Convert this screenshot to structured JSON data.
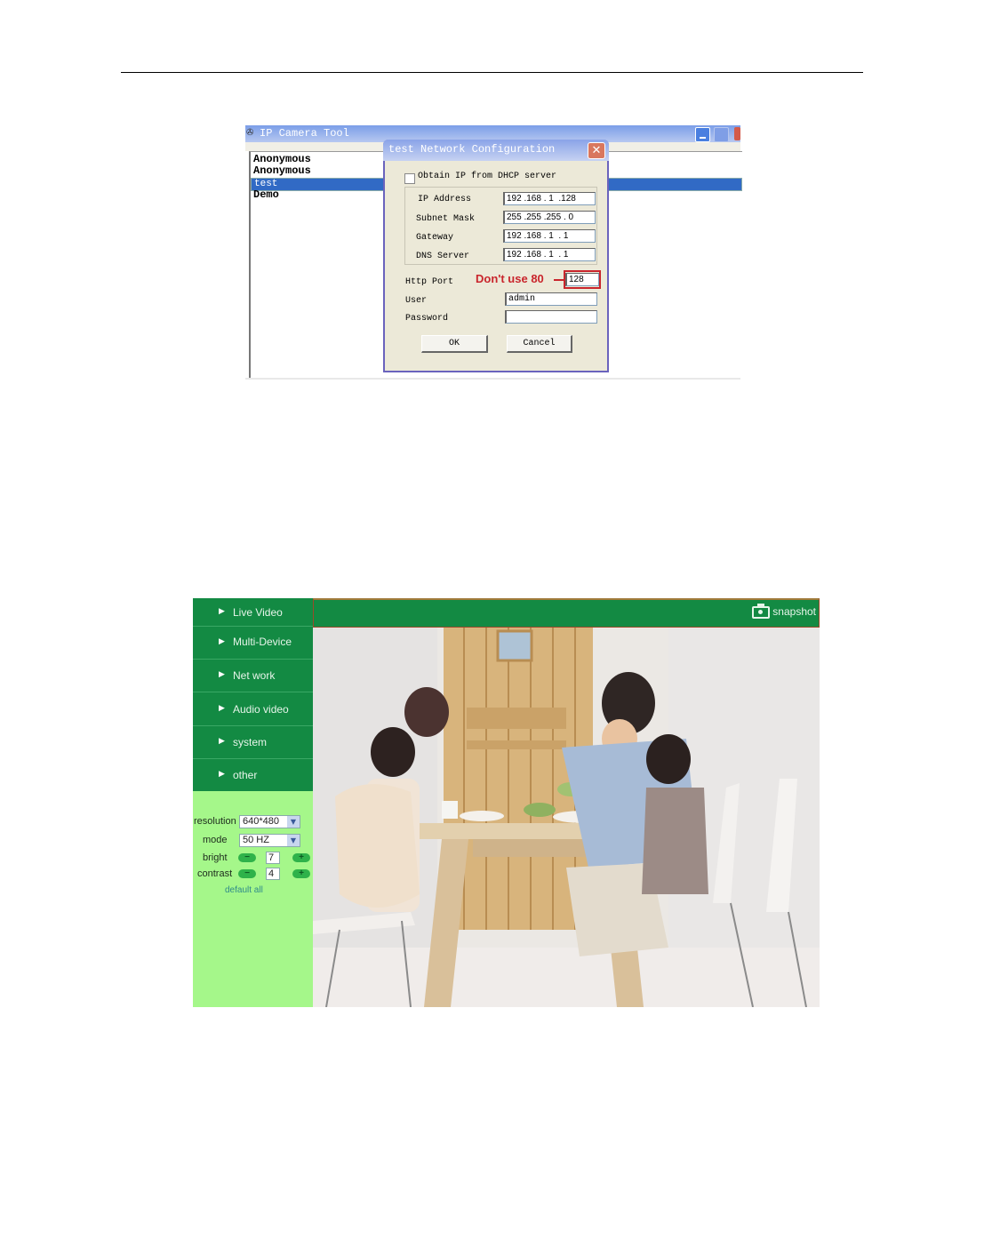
{
  "app_window": {
    "title": "IP Camera Tool",
    "app_icon": "camera-tool-icon",
    "controls": [
      "minimize",
      "maximize",
      "close"
    ],
    "device_list": [
      {
        "name": "Anonymous",
        "selected": false
      },
      {
        "name": "Anonymous",
        "selected": false
      },
      {
        "name": "test",
        "selected": true
      },
      {
        "name": "Demo",
        "selected": false
      }
    ]
  },
  "dialog": {
    "title": "test Network Configuration",
    "close_icon": "close-icon",
    "dhcp_label": "Obtain IP from DHCP server",
    "dhcp_checked": false,
    "fields": [
      {
        "label": "IP Address",
        "value": "192 .168 . 1  .128"
      },
      {
        "label": "Subnet Mask",
        "value": "255 .255 .255 . 0"
      },
      {
        "label": "Gateway",
        "value": "192 .168 . 1  . 1"
      },
      {
        "label": "DNS Server",
        "value": "192 .168 . 1  . 1"
      }
    ],
    "http_port": {
      "label": "Http Port",
      "value": "128"
    },
    "user": {
      "label": "User",
      "value": "admin"
    },
    "password": {
      "label": "Password",
      "value": ""
    },
    "annotation": "Don't use 80",
    "ok_label": "OK",
    "cancel_label": "Cancel"
  },
  "web_ui": {
    "menu": [
      {
        "label": "Live Video"
      },
      {
        "label": "Multi-Device"
      },
      {
        "label": "Net work"
      },
      {
        "label": "Audio video"
      },
      {
        "label": "system"
      },
      {
        "label": "other"
      }
    ],
    "controls": {
      "resolution": {
        "label": "resolution",
        "value": "640*480"
      },
      "mode": {
        "label": "mode",
        "value": "50 HZ"
      },
      "bright": {
        "label": "bright",
        "value": "7",
        "minus": "−",
        "plus": "+"
      },
      "contrast": {
        "label": "contrast",
        "value": "4",
        "minus": "−",
        "plus": "+"
      },
      "default_all": "default all"
    },
    "snapshot_label": "snapshot",
    "video_description": "Live camera feed: family eating at a wooden dining table"
  },
  "colors": {
    "menu_green": "#138a43",
    "sidebar_light_green": "#a5f78a",
    "selection_blue": "#316ac5",
    "annotation_red": "#c9252c"
  }
}
